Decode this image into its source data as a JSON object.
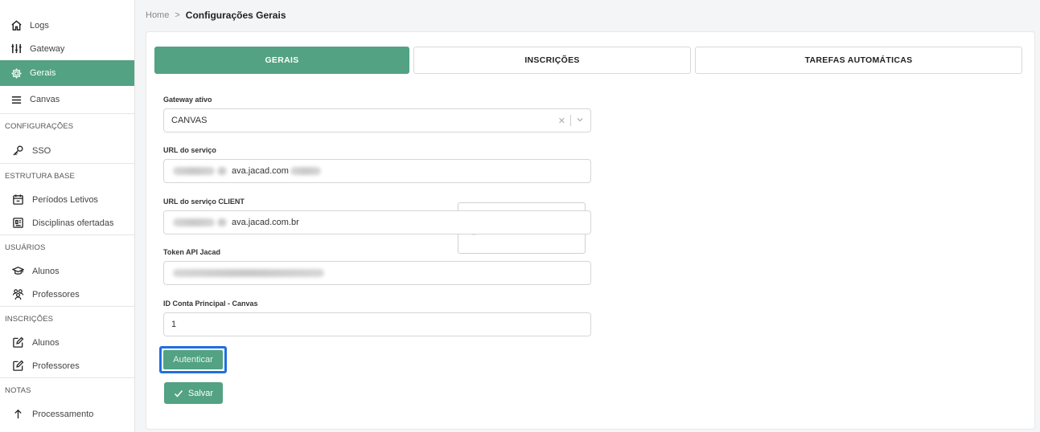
{
  "sidebar": {
    "top_items": [
      {
        "label": "Logs",
        "icon": "home-icon"
      },
      {
        "label": "Gateway",
        "icon": "sliders-icon"
      },
      {
        "label": "Gerais",
        "icon": "gear-icon",
        "active": true
      },
      {
        "label": "Canvas",
        "icon": "menu-icon"
      }
    ],
    "sections": {
      "configuracoes": {
        "title": "CONFIGURAÇÕES",
        "items": [
          "SSO"
        ]
      },
      "estrutura": {
        "title": "ESTRUTURA BASE",
        "items": [
          "Períodos Letivos",
          "Disciplinas ofertadas"
        ]
      },
      "usuarios": {
        "title": "USUÁRIOS",
        "items": [
          "Alunos",
          "Professores"
        ]
      },
      "inscricoes": {
        "title": "INSCRIÇÕES",
        "items": [
          "Alunos",
          "Professores"
        ]
      },
      "notas": {
        "title": "NOTAS",
        "items": [
          "Processamento"
        ]
      }
    }
  },
  "breadcrumb": {
    "home": "Home",
    "separator": ">",
    "current": "Configurações Gerais"
  },
  "tabs": [
    "GERAIS",
    "INSCRIÇÕES",
    "TAREFAS AUTOMÁTICAS"
  ],
  "form": {
    "gateway": {
      "label": "Gateway ativo",
      "value": "CANVAS"
    },
    "url_servico": {
      "label": "URL do serviço",
      "visible_part": "ava.jacad.com"
    },
    "url_client": {
      "label": "URL do serviço CLIENT",
      "visible_part": "ava.jacad.com.br"
    },
    "token": {
      "label": "Token API Jacad"
    },
    "conta": {
      "label": "ID Conta Principal - Canvas",
      "value": "1"
    }
  },
  "buttons": {
    "authenticate": "Autenticar",
    "save": "Salvar"
  },
  "colors": {
    "accent": "#52a283",
    "focus": "#1f6fe0"
  }
}
